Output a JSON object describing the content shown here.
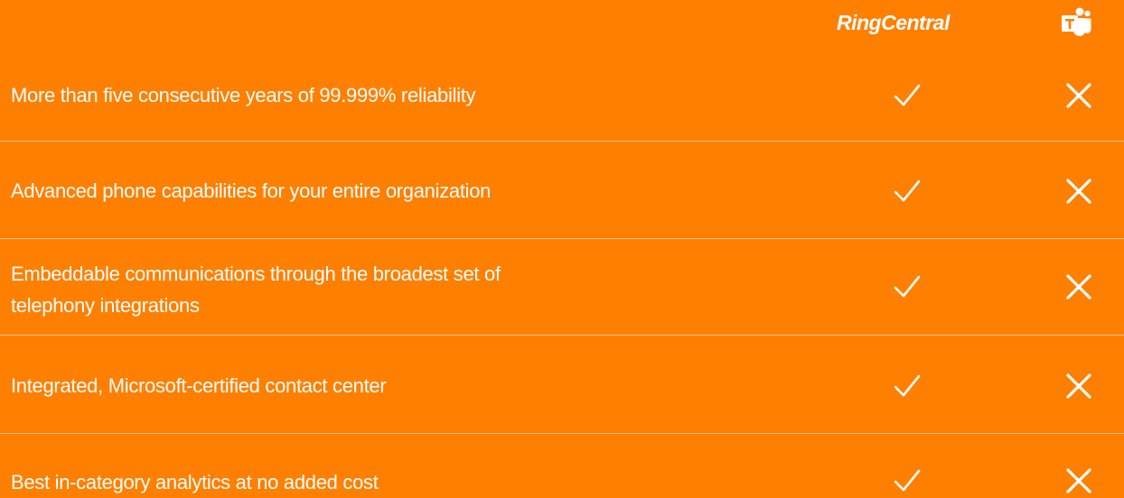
{
  "header": {
    "brand_left": "RingCentral",
    "brand_right_icon": "microsoft-teams-logo"
  },
  "colors": {
    "background": "#FF7F00",
    "foreground": "#FFFFFF"
  },
  "rows": [
    {
      "feature": "More than five consecutive years of 99.999% reliability",
      "ringcentral": "check-icon",
      "teams": "cross-icon"
    },
    {
      "feature": "Advanced phone capabilities for your entire organization",
      "ringcentral": "check-icon",
      "teams": "cross-icon"
    },
    {
      "feature_line1": "Embeddable communications through the broadest set of",
      "feature_line2": "telephony integrations",
      "ringcentral": "check-icon",
      "teams": "cross-icon"
    },
    {
      "feature": "Integrated, Microsoft-certified contact center",
      "ringcentral": "check-icon",
      "teams": "cross-icon"
    },
    {
      "feature": "Best in-category analytics at no added cost",
      "ringcentral": "check-icon",
      "teams": "cross-icon"
    }
  ]
}
